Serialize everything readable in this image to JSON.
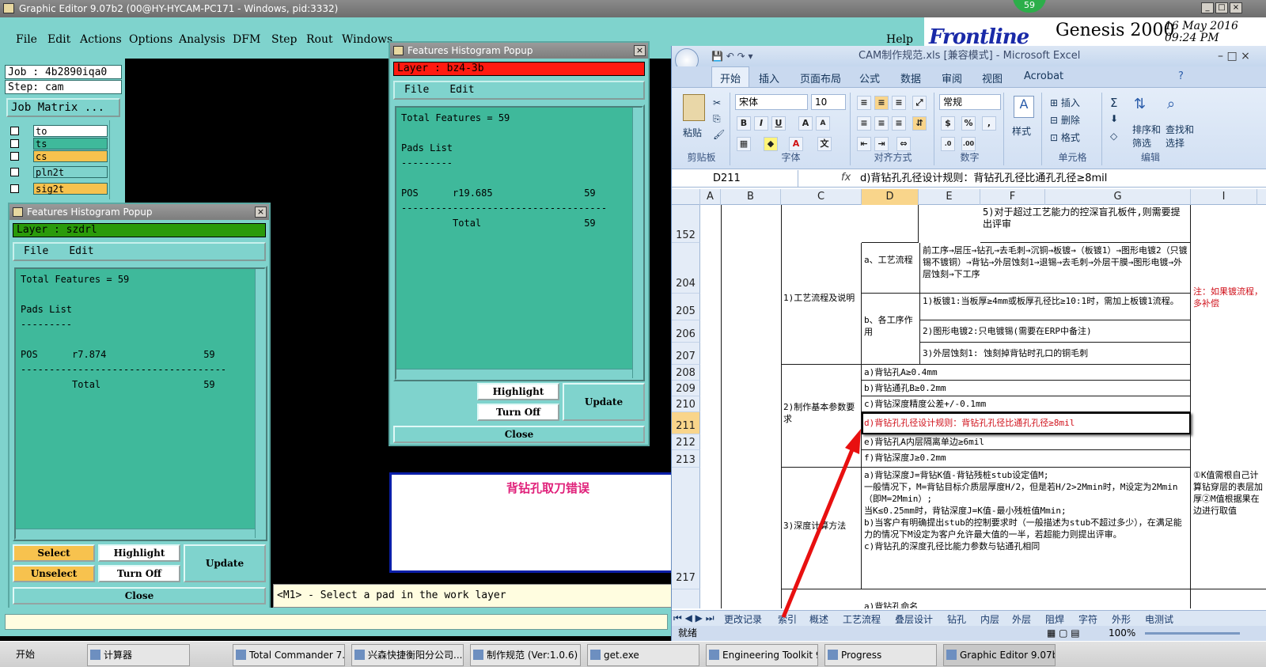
{
  "genesis": {
    "window_title": "Graphic Editor 9.07b2 (00@HY-HYCAM-PC171 - Windows, pid:3332)",
    "menu": [
      "File",
      "Edit",
      "Actions",
      "Options",
      "Analysis",
      "DFM",
      "Step",
      "Rout",
      "Windows"
    ],
    "help": "Help",
    "job_label": "Job : 4b2890iqa0",
    "step_label": "Step: cam",
    "job_matrix": "Job Matrix ...",
    "layers": [
      {
        "name": "to",
        "color": "#ffffff",
        "flag": "🖉"
      },
      {
        "name": "ts",
        "color": "#3fb99b",
        "flag": ""
      },
      {
        "name": "cs",
        "color": "#f7c24e",
        "flag": "🖉"
      },
      {
        "name": "pln2t",
        "color": "#7fd3cd",
        "flag": ""
      },
      {
        "name": "sig2t",
        "color": "#f7c24e",
        "flag": "🖉"
      }
    ],
    "status_message": "<M1> - Select a pad in the work layer",
    "badge": "59",
    "brand": {
      "logo": "Frontline",
      "product": "Genesis 2000",
      "date": "16 May 2016",
      "time": "09:24 PM"
    }
  },
  "popup_left": {
    "title": "Features Histogram Popup",
    "layer": "Layer :  szdrl",
    "layer_color": "#2a9a0a",
    "menu": [
      "File",
      "Edit"
    ],
    "list": "Total Features = 59\n\nPads List\n---------\n\nPOS      r7.874                 59\n------------------------------------\n         Total                  59",
    "buttons": {
      "select": "Select",
      "unselect": "Unselect",
      "highlight": "Highlight",
      "turn_off": "Turn Off",
      "update": "Update",
      "close": "Close"
    }
  },
  "popup_top": {
    "title": "Features Histogram Popup",
    "layer": "Layer :  bz4-3b",
    "layer_color": "#ff1a10",
    "menu": [
      "File",
      "Edit"
    ],
    "list": "Total Features = 59\n\nPads List\n---------\n\nPOS      r19.685                59\n------------------------------------\n         Total                  59",
    "buttons": {
      "highlight": "Highlight",
      "turn_off": "Turn Off",
      "update": "Update",
      "close": "Close"
    }
  },
  "annotation": {
    "text": "背钻孔取刀错误",
    "color": "#e0207a",
    "arrow_color": "#e81010"
  },
  "excel": {
    "title": "CAM制作规范.xls  [兼容模式] - Microsoft Excel",
    "tabs": [
      "开始",
      "插入",
      "页面布局",
      "公式",
      "数据",
      "审阅",
      "视图",
      "Acrobat"
    ],
    "active_tab": "开始",
    "ribbon": {
      "paste": "粘贴",
      "clipboard": "剪贴板",
      "font_name": "宋体",
      "font_size": "10",
      "font_group": "字体",
      "align_group": "对齐方式",
      "number_format": "常规",
      "number_group": "数字",
      "style": "样式",
      "insert": "插入",
      "delete": "删除",
      "format": "格式",
      "cells_group": "单元格",
      "sort": "排序和",
      "sort2": "筛选",
      "find": "查找和",
      "find2": "选择",
      "edit_group": "编辑"
    },
    "name_box": "D211",
    "fx": "fx",
    "formula": "d)背钻孔孔径设计规则：背钻孔孔径比通孔孔径≥8mil",
    "columns": [
      "A",
      "B",
      "C",
      "D",
      "E",
      "F",
      "G",
      "I"
    ],
    "selected_column": "D",
    "rows": [
      {
        "num": "152"
      },
      {
        "num": "204"
      },
      {
        "num": "205"
      },
      {
        "num": "206"
      },
      {
        "num": "207"
      },
      {
        "num": "208"
      },
      {
        "num": "209"
      },
      {
        "num": "210"
      },
      {
        "num": "211"
      },
      {
        "num": "212"
      },
      {
        "num": "213"
      },
      {
        "num": "217"
      }
    ],
    "cells": {
      "r152": "5)对于超过工艺能力的控深盲孔板件,则需要提出评审",
      "c_flow": "1)工艺流程及说明",
      "d_flow": "a、工艺流程",
      "e_flow": "前工序→层压→钻孔→去毛刺→沉铜→板镀→（板镀1）→图形电镀2（只镀锡不镀铜）→背钻→外层蚀刻1→退锡→去毛刺→外层干膜→图形电镀→外层蚀刻→下工序",
      "d_role": "b、各工序作用",
      "e_205": "1)板镀1:当板厚≥4mm或板厚孔径比≥10:1时，需加上板镀1流程。",
      "e_206": "2)图形电镀2:只电镀锡(需要在ERP中备注)",
      "e_207": "3)外层蚀刻1: 蚀刻掉背钻时孔口的铜毛刺",
      "i_note": "注：如果镀流程，多补偿",
      "c_basic": "2)制作基本参数要求",
      "r208": "a)背钻孔A≥0.4mm",
      "r209": "b)背钻通孔B≥0.2mm",
      "r210": "c)背钻深度精度公差+/-0.1mm",
      "r211": "d)背钻孔孔径设计规则：背钻孔孔径比通孔孔径≥8mil",
      "r212": "e)背钻孔A内层隔离单边≥6mil",
      "r213": "f)背钻深度J≥0.2mm",
      "c_depth": "3)深度计算方法",
      "r_depth": "a)背钻深度J=背钻K值-背钻残桩stub设定值M;\n一般情况下，M=背钻目标介质层厚度H/2，但是若H/2>2Mmin时，M设定为2Mmin（即M=2Mmin）;\n当K≤0.25mm时，背钻深度J=K值-最小残桩值Mmin;\nb)当客户有明确提出stub的控制要求时（一般描述为stub不超过多少），在满足能力的情况下M设定为客户允许最大值的一半，若超能力则提出评审。\nc)背钻孔的深度孔径比能力参数与钻通孔相同",
      "i_depth": "①K值需根自己计算钻穿层的表层加厚②M值根据果在边进行取值",
      "r_name": "a)背钻孔命名"
    },
    "sheet_tabs": [
      "更改记录",
      "索引",
      "概述",
      "工艺流程",
      "叠层设计",
      "钻孔",
      "内层",
      "外层",
      "阻焊",
      "字符",
      "外形",
      "电测试"
    ],
    "status": "就绪",
    "zoom": "100%"
  },
  "taskbar": {
    "start": "开始",
    "items": [
      "计算器",
      "Total Commander 7.0 ...",
      "兴森快捷衡阳分公司...",
      "制作规范 (Ver:1.0.6)",
      "get.exe",
      "Engineering Toolkit 9.0...",
      "Progress",
      "Graphic Editor 9.07b2 (..."
    ]
  }
}
